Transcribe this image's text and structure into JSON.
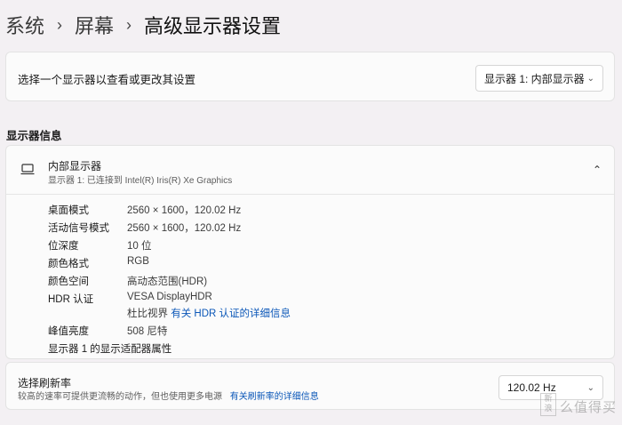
{
  "breadcrumb": {
    "items": [
      "系统",
      "屏幕"
    ],
    "current": "高级显示器设置",
    "separator": "›"
  },
  "display_select": {
    "label": "选择一个显示器以查看或更改其设置",
    "selected": "显示器 1: 内部显示器"
  },
  "section": {
    "title": "显示器信息"
  },
  "display_info": {
    "name": "内部显示器",
    "subtitle": "显示器 1: 已连接到 Intel(R) Iris(R) Xe Graphics",
    "rows": [
      {
        "key": "桌面模式",
        "value": "2560 × 1600，120.02 Hz"
      },
      {
        "key": "活动信号模式",
        "value": "2560 × 1600，120.02 Hz"
      },
      {
        "key": "位深度",
        "value": "10 位"
      },
      {
        "key": "颜色格式",
        "value": "RGB"
      },
      {
        "key": "颜色空间",
        "value": "高动态范围(HDR)"
      },
      {
        "key": "HDR 认证",
        "value": "VESA DisplayHDR",
        "value2_prefix": "杜比视界",
        "value2_link": "有关 HDR 认证的详细信息"
      },
      {
        "key": "峰值亮度",
        "value": "508 尼特"
      }
    ],
    "adapter_link": "显示器 1 的显示适配器属性"
  },
  "refresh": {
    "title": "选择刷新率",
    "desc": "较高的速率可提供更流畅的动作，但也使用更多电源",
    "link": "有关刷新率的详细信息",
    "selected": "120.02 Hz"
  },
  "watermark": {
    "seal": "新浪",
    "text": "么值得买"
  },
  "icons": {
    "monitor": "laptop-icon",
    "chevron": "chevron-down-icon",
    "collapse": "chevron-up-icon"
  }
}
